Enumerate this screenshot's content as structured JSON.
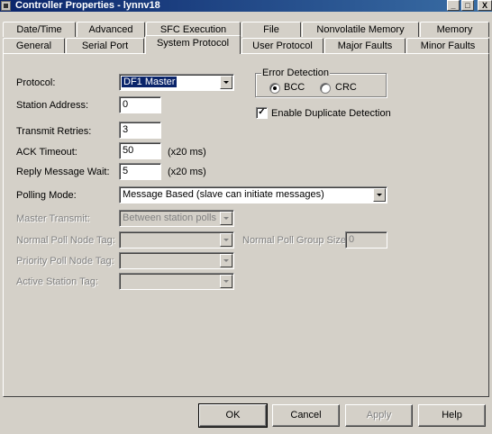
{
  "window": {
    "title": "Controller Properties - lynnv18",
    "controls": [
      "_",
      "□",
      "X"
    ]
  },
  "tabs": {
    "row_back": [
      "Date/Time",
      "Advanced",
      "SFC Execution",
      "File",
      "Nonvolatile Memory",
      "Memory"
    ],
    "row_front": [
      "General",
      "Serial Port",
      "System Protocol",
      "User Protocol",
      "Major Faults",
      "Minor Faults"
    ],
    "active": "System Protocol"
  },
  "form": {
    "protocol_label": "Protocol:",
    "protocol_value": "DF1 Master",
    "station_address_label": "Station Address:",
    "station_address_value": "0",
    "transmit_retries_label": "Transmit Retries:",
    "transmit_retries_value": "3",
    "ack_timeout_label": "ACK Timeout:",
    "ack_timeout_value": "50",
    "ack_timeout_unit": "(x20 ms)",
    "reply_wait_label": "Reply Message Wait:",
    "reply_wait_value": "5",
    "reply_wait_unit": "(x20 ms)",
    "polling_mode_label": "Polling Mode:",
    "polling_mode_value": "Message Based (slave can initiate messages)",
    "master_transmit_label": "Master Transmit:",
    "master_transmit_value": "Between station polls",
    "normal_poll_node_tag_label": "Normal Poll Node Tag:",
    "normal_poll_node_tag_value": "",
    "normal_poll_group_size_label": "Normal Poll Group Size:",
    "normal_poll_group_size_value": "0",
    "priority_poll_node_tag_label": "Priority Poll Node Tag:",
    "priority_poll_node_tag_value": "",
    "active_station_tag_label": "Active Station Tag:",
    "active_station_tag_value": ""
  },
  "error_detection": {
    "legend": "Error Detection",
    "options": [
      "BCC",
      "CRC"
    ],
    "selected": "BCC"
  },
  "duplicate_detection": {
    "label": "Enable Duplicate Detection",
    "checked": true,
    "mark": "✓"
  },
  "buttons": {
    "ok": "OK",
    "cancel": "Cancel",
    "apply": "Apply",
    "help": "Help"
  },
  "colors": {
    "titlebar": "#0a246a",
    "face": "#d4d0c8",
    "selection": "#0a246a"
  }
}
